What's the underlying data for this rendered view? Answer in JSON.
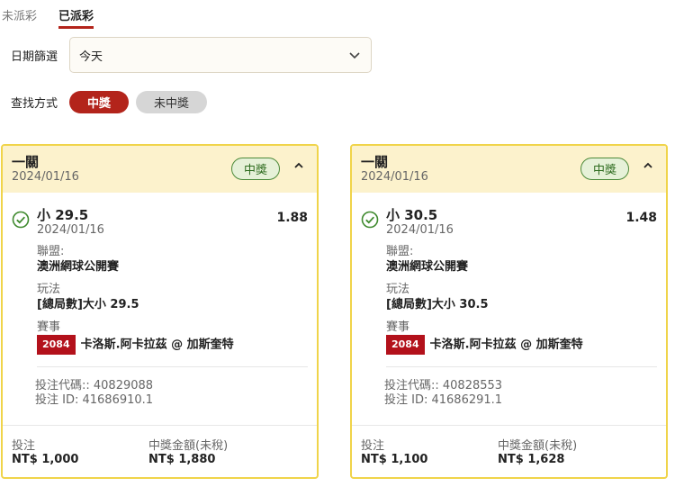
{
  "tabs": [
    "未派彩",
    "已派彩"
  ],
  "filter": {
    "date_label": "日期篩選",
    "date_value": "今天",
    "search_label": "查找方式",
    "win_label": "中獎",
    "lose_label": "未中獎"
  },
  "cards": [
    {
      "name": "一關",
      "date": "2024/01/16",
      "badge": "中獎",
      "pick": "小 29.5",
      "pick_date": "2024/01/16",
      "odds": "1.88",
      "league_key": "聯盟:",
      "league": "澳洲網球公開賽",
      "play_key": "玩法",
      "play": "[總局數]大小 29.5",
      "event_key": "賽事",
      "event_code": "2084",
      "event": "卡洛斯.阿卡拉茲 @ 加斯奎特",
      "bet_code": "投注代碼:: 40829088",
      "bet_id": "投注 ID: 41686910.1",
      "stake_key": "投注",
      "stake": "NT$ 1,000",
      "payout_key": "中獎金額(未稅)",
      "payout": "NT$ 1,880"
    },
    {
      "name": "一關",
      "date": "2024/01/16",
      "badge": "中獎",
      "pick": "小 30.5",
      "pick_date": "2024/01/16",
      "odds": "1.48",
      "league_key": "聯盟:",
      "league": "澳洲網球公開賽",
      "play_key": "玩法",
      "play": "[總局數]大小 30.5",
      "event_key": "賽事",
      "event_code": "2084",
      "event": "卡洛斯.阿卡拉茲 @ 加斯奎特",
      "bet_code": "投注代碼:: 40828553",
      "bet_id": "投注 ID: 41686291.1",
      "stake_key": "投注",
      "stake": "NT$ 1,100",
      "payout_key": "中獎金額(未稅)",
      "payout": "NT$ 1,628"
    }
  ],
  "colors": {
    "accent": "#b3241b",
    "card_border": "#f0d44a",
    "card_header": "#fcf2cc",
    "win_green": "#2d6b1e"
  }
}
